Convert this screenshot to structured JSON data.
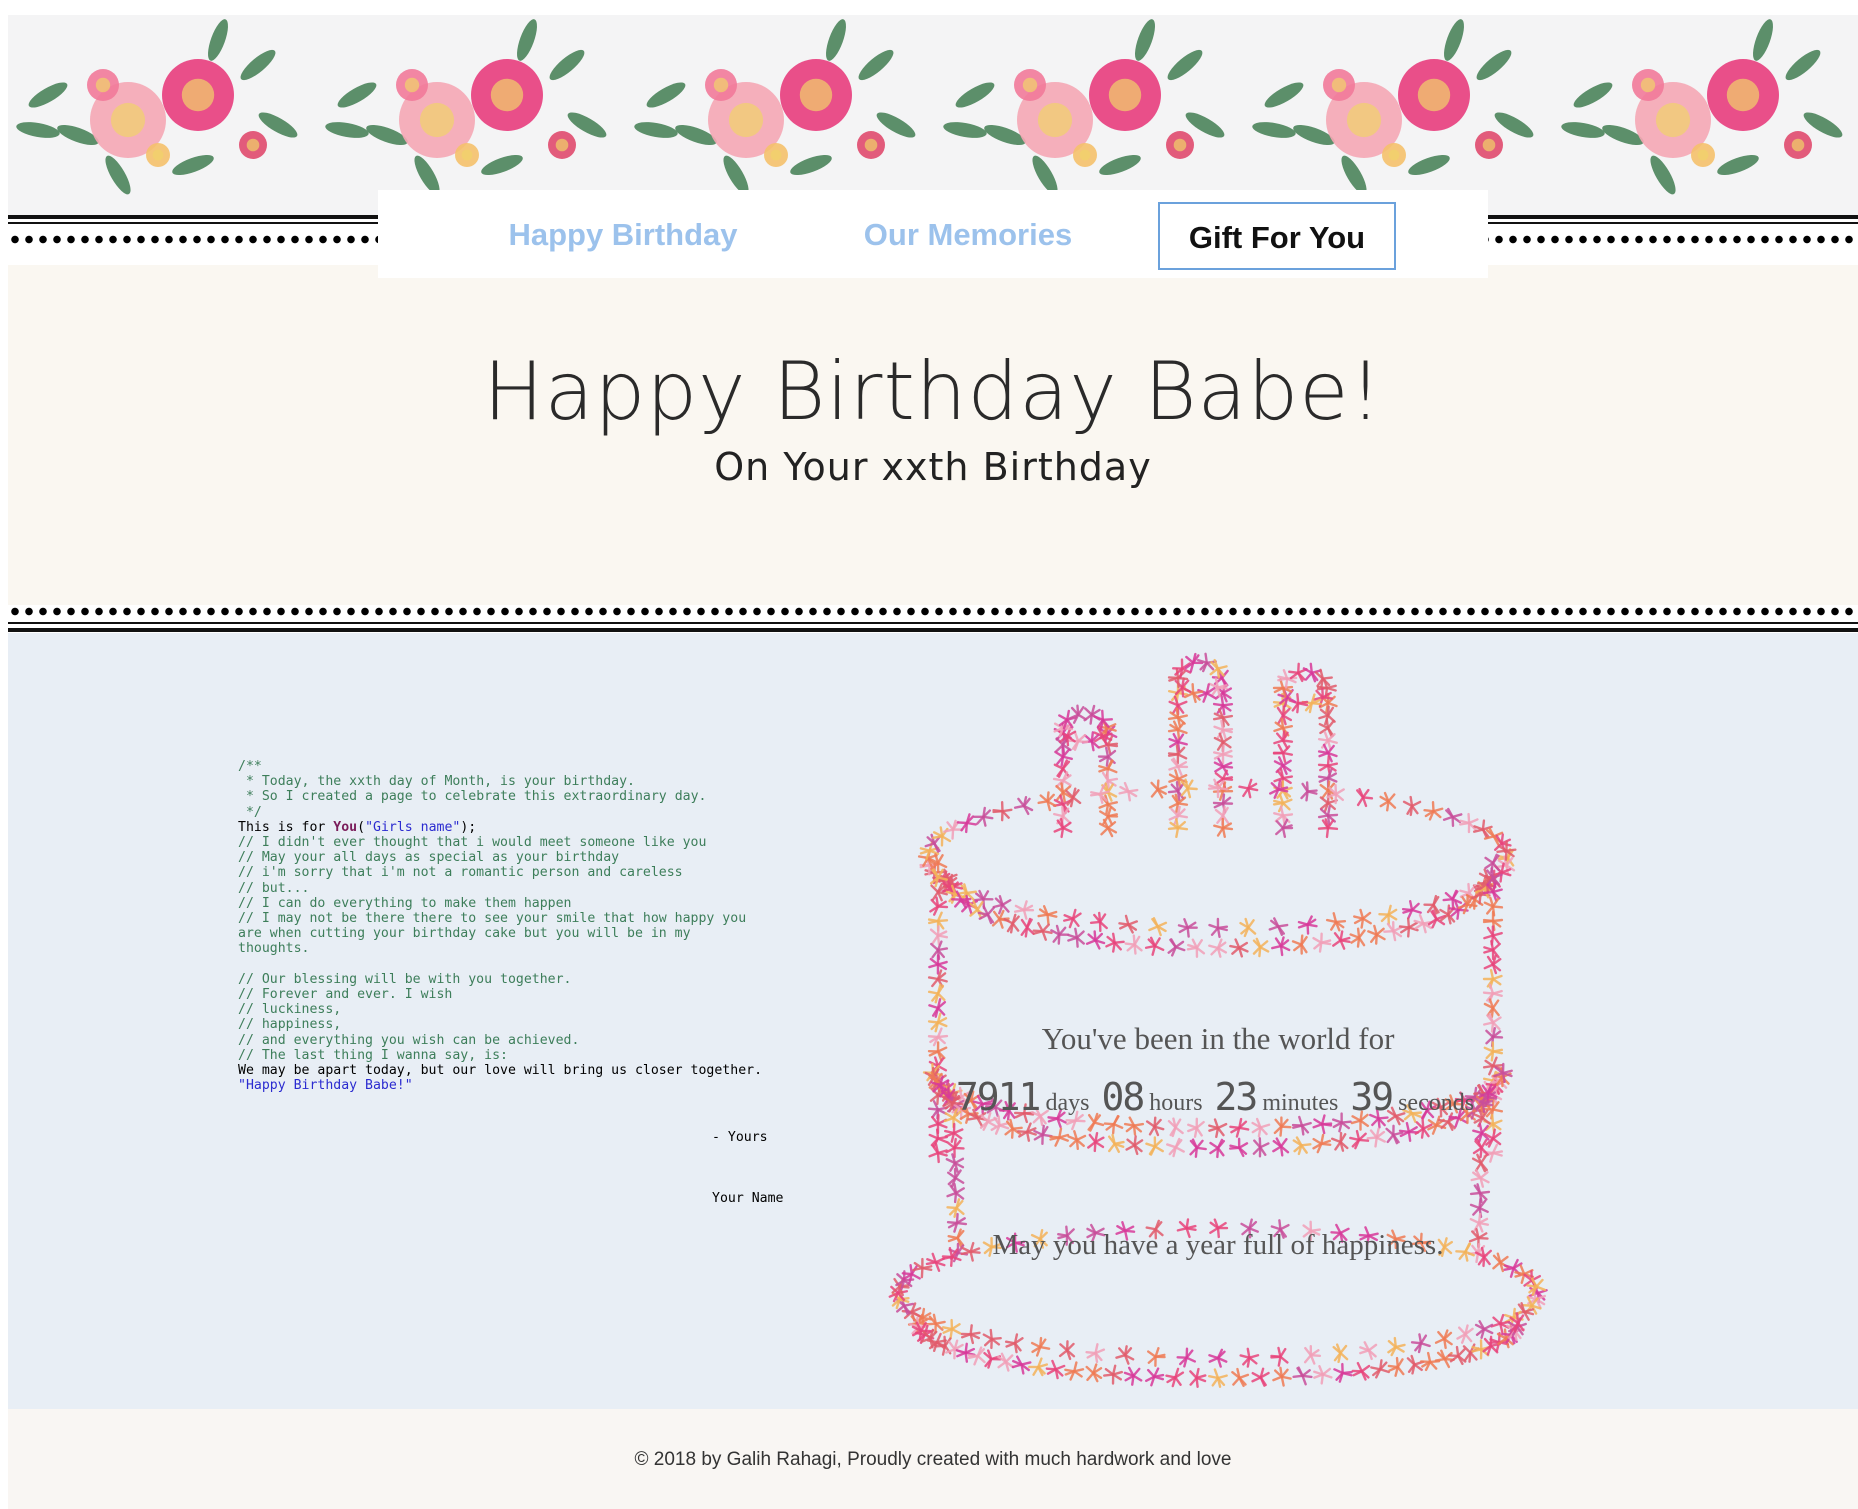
{
  "nav": {
    "items": [
      {
        "label": "Happy Birthday"
      },
      {
        "label": "Our Memories"
      },
      {
        "label": "Gift For You"
      }
    ],
    "active_color": "#6ba1dc",
    "link_color": "#9cc2ec"
  },
  "hero": {
    "title": "Happy Birthday Babe!",
    "subtitle": "On Your xxth Birthday"
  },
  "letter": {
    "lines": [
      {
        "cls": "cm",
        "text": "/**"
      },
      {
        "cls": "cm",
        "text": " * Today, the xxth day of Month, is your birthday."
      },
      {
        "cls": "cm",
        "text": " * So I created a page to celebrate this extraordinary day."
      },
      {
        "cls": "cm",
        "text": " */"
      },
      {
        "cls": "mixed",
        "text": ""
      },
      {
        "cls": "cm",
        "text": "// I didn't ever thought that i would meet someone like you"
      },
      {
        "cls": "cm",
        "text": "// May your all days as special as your birthday"
      },
      {
        "cls": "cm",
        "text": "// i'm sorry that i'm not a romantic person and careless"
      },
      {
        "cls": "cm",
        "text": "// but..."
      },
      {
        "cls": "cm",
        "text": "// I can do everything to make them happen"
      },
      {
        "cls": "cm",
        "text": "// I may not be there there to see your smile that how happy you"
      },
      {
        "cls": "cm",
        "text": "are when cutting your birthday cake but you will be in my"
      },
      {
        "cls": "cm",
        "text": "thoughts."
      },
      {
        "cls": "gap",
        "text": ""
      },
      {
        "cls": "cm",
        "text": "// Our blessing will be with you together."
      },
      {
        "cls": "cm",
        "text": "// Forever and ever. I wish"
      },
      {
        "cls": "cm",
        "text": "// luckiness,"
      },
      {
        "cls": "cm",
        "text": "// happiness,"
      },
      {
        "cls": "cm",
        "text": "// and everything you wish can be achieved."
      },
      {
        "cls": "cm",
        "text": "// The last thing I wanna say, is:"
      },
      {
        "cls": "plain",
        "text": "We may be apart today, but our love will bring us closer together."
      },
      {
        "cls": "str",
        "text": "\"Happy Birthday Babe!\""
      }
    ],
    "this_is_for": "This is for ",
    "you_fn": "You",
    "paren_open": "(",
    "girls_name": "\"Girls name\"",
    "paren_close": ");",
    "signature_yours": "- Yours",
    "signature_name": "Your Name"
  },
  "counter": {
    "heading": "You've been in the world for",
    "days": "7911",
    "days_label": "days",
    "hours": "08",
    "hours_label": "hours",
    "minutes": "23",
    "minutes_label": "minutes",
    "seconds": "39",
    "seconds_label": "seconds",
    "wish": "May you have a year full of happiness."
  },
  "footer": {
    "text": "© 2018 by Galih Rahagi, Proudly created with much hardwork and love"
  }
}
